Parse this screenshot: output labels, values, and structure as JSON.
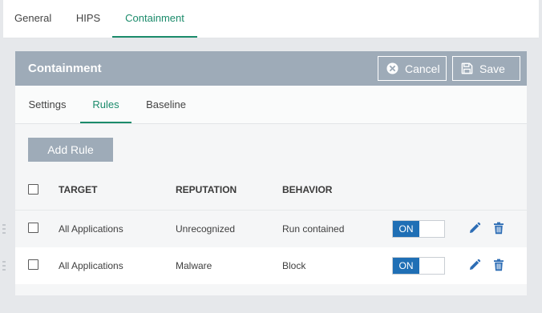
{
  "top_tabs": [
    {
      "label": "General"
    },
    {
      "label": "HIPS"
    },
    {
      "label": "Containment"
    }
  ],
  "panel": {
    "title": "Containment",
    "cancel_label": "Cancel",
    "save_label": "Save"
  },
  "sub_tabs": [
    {
      "label": "Settings"
    },
    {
      "label": "Rules"
    },
    {
      "label": "Baseline"
    }
  ],
  "add_rule_label": "Add Rule",
  "table": {
    "columns": [
      "TARGET",
      "REPUTATION",
      "BEHAVIOR"
    ],
    "rows": [
      {
        "target": "All Applications",
        "reputation": "Unrecognized",
        "behavior": "Run contained",
        "toggle": "ON"
      },
      {
        "target": "All Applications",
        "reputation": "Malware",
        "behavior": "Block",
        "toggle": "ON"
      }
    ]
  },
  "colors": {
    "accent_green": "#1b8b6b",
    "header_gray": "#9eabb8",
    "toggle_blue": "#1f6fb5",
    "icon_blue": "#2d6db5"
  }
}
